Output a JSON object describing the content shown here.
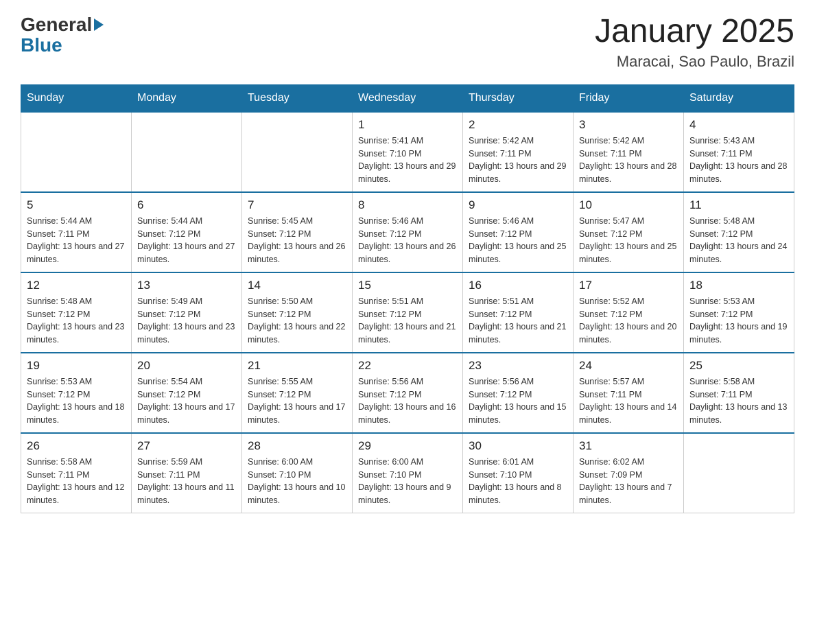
{
  "header": {
    "logo_general": "General",
    "logo_blue": "Blue",
    "title": "January 2025",
    "subtitle": "Maracai, Sao Paulo, Brazil"
  },
  "calendar": {
    "days_of_week": [
      "Sunday",
      "Monday",
      "Tuesday",
      "Wednesday",
      "Thursday",
      "Friday",
      "Saturday"
    ],
    "weeks": [
      [
        {
          "day": "",
          "info": ""
        },
        {
          "day": "",
          "info": ""
        },
        {
          "day": "",
          "info": ""
        },
        {
          "day": "1",
          "info": "Sunrise: 5:41 AM\nSunset: 7:10 PM\nDaylight: 13 hours and 29 minutes."
        },
        {
          "day": "2",
          "info": "Sunrise: 5:42 AM\nSunset: 7:11 PM\nDaylight: 13 hours and 29 minutes."
        },
        {
          "day": "3",
          "info": "Sunrise: 5:42 AM\nSunset: 7:11 PM\nDaylight: 13 hours and 28 minutes."
        },
        {
          "day": "4",
          "info": "Sunrise: 5:43 AM\nSunset: 7:11 PM\nDaylight: 13 hours and 28 minutes."
        }
      ],
      [
        {
          "day": "5",
          "info": "Sunrise: 5:44 AM\nSunset: 7:11 PM\nDaylight: 13 hours and 27 minutes."
        },
        {
          "day": "6",
          "info": "Sunrise: 5:44 AM\nSunset: 7:12 PM\nDaylight: 13 hours and 27 minutes."
        },
        {
          "day": "7",
          "info": "Sunrise: 5:45 AM\nSunset: 7:12 PM\nDaylight: 13 hours and 26 minutes."
        },
        {
          "day": "8",
          "info": "Sunrise: 5:46 AM\nSunset: 7:12 PM\nDaylight: 13 hours and 26 minutes."
        },
        {
          "day": "9",
          "info": "Sunrise: 5:46 AM\nSunset: 7:12 PM\nDaylight: 13 hours and 25 minutes."
        },
        {
          "day": "10",
          "info": "Sunrise: 5:47 AM\nSunset: 7:12 PM\nDaylight: 13 hours and 25 minutes."
        },
        {
          "day": "11",
          "info": "Sunrise: 5:48 AM\nSunset: 7:12 PM\nDaylight: 13 hours and 24 minutes."
        }
      ],
      [
        {
          "day": "12",
          "info": "Sunrise: 5:48 AM\nSunset: 7:12 PM\nDaylight: 13 hours and 23 minutes."
        },
        {
          "day": "13",
          "info": "Sunrise: 5:49 AM\nSunset: 7:12 PM\nDaylight: 13 hours and 23 minutes."
        },
        {
          "day": "14",
          "info": "Sunrise: 5:50 AM\nSunset: 7:12 PM\nDaylight: 13 hours and 22 minutes."
        },
        {
          "day": "15",
          "info": "Sunrise: 5:51 AM\nSunset: 7:12 PM\nDaylight: 13 hours and 21 minutes."
        },
        {
          "day": "16",
          "info": "Sunrise: 5:51 AM\nSunset: 7:12 PM\nDaylight: 13 hours and 21 minutes."
        },
        {
          "day": "17",
          "info": "Sunrise: 5:52 AM\nSunset: 7:12 PM\nDaylight: 13 hours and 20 minutes."
        },
        {
          "day": "18",
          "info": "Sunrise: 5:53 AM\nSunset: 7:12 PM\nDaylight: 13 hours and 19 minutes."
        }
      ],
      [
        {
          "day": "19",
          "info": "Sunrise: 5:53 AM\nSunset: 7:12 PM\nDaylight: 13 hours and 18 minutes."
        },
        {
          "day": "20",
          "info": "Sunrise: 5:54 AM\nSunset: 7:12 PM\nDaylight: 13 hours and 17 minutes."
        },
        {
          "day": "21",
          "info": "Sunrise: 5:55 AM\nSunset: 7:12 PM\nDaylight: 13 hours and 17 minutes."
        },
        {
          "day": "22",
          "info": "Sunrise: 5:56 AM\nSunset: 7:12 PM\nDaylight: 13 hours and 16 minutes."
        },
        {
          "day": "23",
          "info": "Sunrise: 5:56 AM\nSunset: 7:12 PM\nDaylight: 13 hours and 15 minutes."
        },
        {
          "day": "24",
          "info": "Sunrise: 5:57 AM\nSunset: 7:11 PM\nDaylight: 13 hours and 14 minutes."
        },
        {
          "day": "25",
          "info": "Sunrise: 5:58 AM\nSunset: 7:11 PM\nDaylight: 13 hours and 13 minutes."
        }
      ],
      [
        {
          "day": "26",
          "info": "Sunrise: 5:58 AM\nSunset: 7:11 PM\nDaylight: 13 hours and 12 minutes."
        },
        {
          "day": "27",
          "info": "Sunrise: 5:59 AM\nSunset: 7:11 PM\nDaylight: 13 hours and 11 minutes."
        },
        {
          "day": "28",
          "info": "Sunrise: 6:00 AM\nSunset: 7:10 PM\nDaylight: 13 hours and 10 minutes."
        },
        {
          "day": "29",
          "info": "Sunrise: 6:00 AM\nSunset: 7:10 PM\nDaylight: 13 hours and 9 minutes."
        },
        {
          "day": "30",
          "info": "Sunrise: 6:01 AM\nSunset: 7:10 PM\nDaylight: 13 hours and 8 minutes."
        },
        {
          "day": "31",
          "info": "Sunrise: 6:02 AM\nSunset: 7:09 PM\nDaylight: 13 hours and 7 minutes."
        },
        {
          "day": "",
          "info": ""
        }
      ]
    ]
  }
}
